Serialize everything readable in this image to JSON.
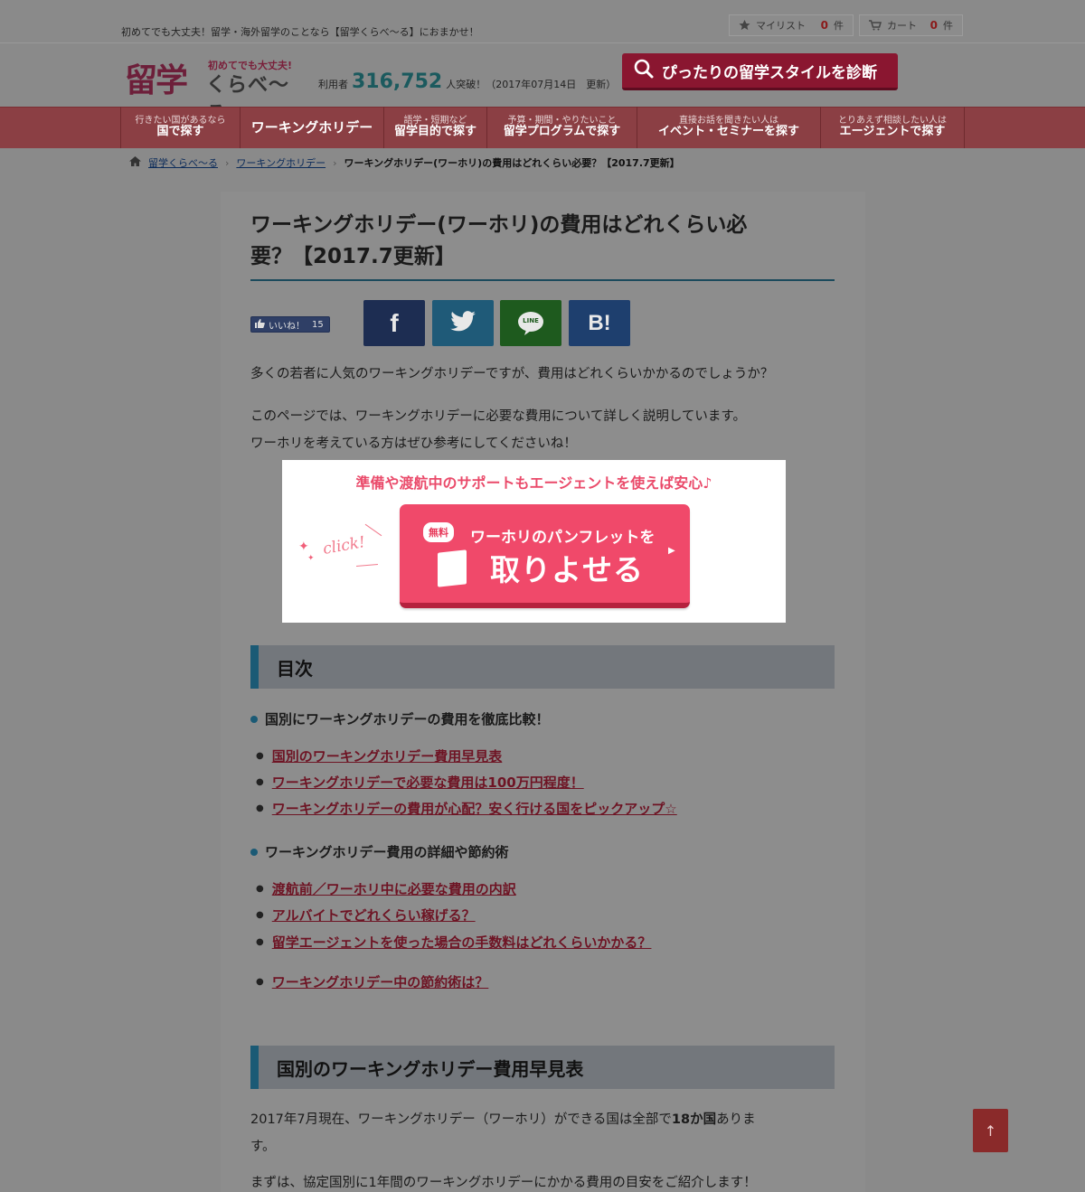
{
  "topbar": {
    "tagline": "初めてでも大丈夫！留学・海外留学のことなら【留学くらべ〜る】におまかせ！",
    "mylist_label": "マイリスト",
    "mylist_count": "0",
    "cart_label": "カート",
    "cart_count": "0",
    "count_unit": "件"
  },
  "header": {
    "logo_main": "留学",
    "logo_sub": "初めてでも大丈夫!",
    "logo_kana": "くらべ〜る",
    "users_prefix": "利用者",
    "users_count": "316,752",
    "users_suffix": "人突破！（2017年07月14日　更新）",
    "diagnose_button": "ぴったりの留学スタイルを診断"
  },
  "nav": [
    {
      "sub": "行きたい国があるなら",
      "main": "国で探す"
    },
    {
      "sub": "",
      "main": "ワーキングホリデー"
    },
    {
      "sub": "語学・短期など",
      "main": "留学目的で探す"
    },
    {
      "sub": "予算・期間・やりたいこと",
      "main": "留学プログラムで探す"
    },
    {
      "sub": "直接お話を聞きたい人は",
      "main": "イベント・セミナーを探す"
    },
    {
      "sub": "とりあえず相談したい人は",
      "main": "エージェントで探す"
    }
  ],
  "breadcrumb": {
    "home": "留学くらべ〜る",
    "section": "ワーキングホリデー",
    "current": "ワーキングホリデー(ワーホリ)の費用はどれくらい必要？【2017.7更新】"
  },
  "article": {
    "title_line1": "ワーキングホリデー(ワーホリ)の費用はどれくらい必",
    "title_line2": "要？【2017.7更新】",
    "like_label": "いいね！",
    "like_count": "15",
    "share_facebook": "f",
    "share_line": "LINE",
    "share_hatena": "B!",
    "intro1": "多くの若者に人気のワーキングホリデーですが、費用はどれくらいかかるのでしょうか？",
    "intro2": "このページでは、ワーキングホリデーに必要な費用について詳しく説明しています。",
    "intro3": "ワーホリを考えている方はぜひ参考にしてくださいね！"
  },
  "banner": {
    "headline": "準備や渡航中のサポートもエージェントを使えば安心♪",
    "click_text": "click!",
    "free_badge": "無料",
    "cta_line1": "ワーホリのパンフレットを",
    "cta_line2": "取りよせる"
  },
  "toc": {
    "heading": "目次",
    "section1": "国別にワーキングホリデーの費用を徹底比較！",
    "section1_links": [
      "国別のワーキングホリデー費用早見表",
      "ワーキングホリデーで必要な費用は100万円程度！",
      "ワーキングホリデーの費用が心配？安く行ける国をピックアップ☆"
    ],
    "section2": "ワーキングホリデー費用の詳細や節約術",
    "section2_links": [
      "渡航前／ワーホリ中に必要な費用の内訳",
      "アルバイトでどれくらい稼げる？",
      "留学エージェントを使った場合の手数料はどれくらいかかる？",
      "ワーキングホリデー中の節約術は？"
    ]
  },
  "section_table": {
    "heading": "国別のワーキングホリデー費用早見表",
    "para1_a": "2017年7月現在、ワーキングホリデー（ワーホリ）ができる国は全部で",
    "para1_b": "18か国",
    "para1_c": "ありま",
    "para1_d": "す。",
    "para2": "まずは、協定国別に1年間のワーキングホリデーにかかる費用の目安をご紹介します！"
  },
  "pagetop": "↑"
}
